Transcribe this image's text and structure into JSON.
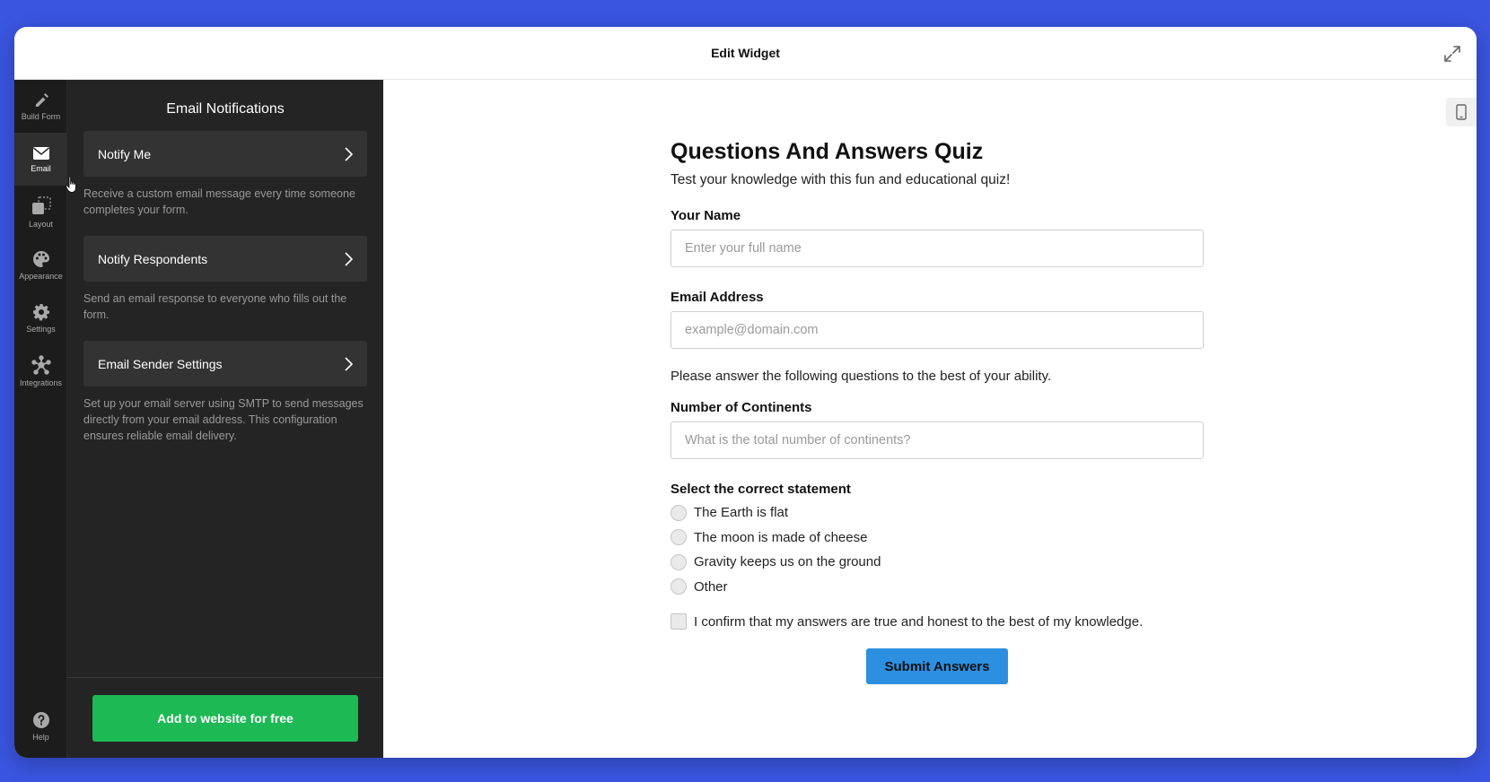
{
  "window": {
    "title": "Edit Widget"
  },
  "rail": {
    "items": [
      {
        "label": "Build Form",
        "icon": "pencil-icon"
      },
      {
        "label": "Email",
        "icon": "envelope-icon",
        "active": true
      },
      {
        "label": "Layout",
        "icon": "layout-icon"
      },
      {
        "label": "Appearance",
        "icon": "palette-icon"
      },
      {
        "label": "Settings",
        "icon": "gear-icon"
      },
      {
        "label": "Integrations",
        "icon": "integrations-icon"
      }
    ],
    "help": {
      "label": "Help",
      "icon": "help-icon"
    }
  },
  "panel": {
    "title": "Email Notifications",
    "cards": [
      {
        "label": "Notify Me",
        "desc": "Receive a custom email message every time someone completes your form."
      },
      {
        "label": "Notify Respondents",
        "desc": "Send an email response to everyone who fills out the form."
      },
      {
        "label": "Email Sender Settings",
        "desc": "Set up your email server using SMTP to send messages directly from your email address. This configuration ensures reliable email delivery."
      }
    ],
    "add_button": "Add to website for free"
  },
  "form": {
    "title": "Questions And Answers Quiz",
    "subtitle": "Test your knowledge with this fun and educational quiz!",
    "name_label": "Your Name",
    "name_placeholder": "Enter your full name",
    "email_label": "Email Address",
    "email_placeholder": "example@domain.com",
    "instructions": "Please answer the following questions to the best of your ability.",
    "continents_label": "Number of Continents",
    "continents_placeholder": "What is the total number of continents?",
    "statement_label": "Select the correct statement",
    "options": [
      "The Earth is flat",
      "The moon is made of cheese",
      "Gravity keeps us on the ground",
      "Other"
    ],
    "confirm_text": "I confirm that my answers are true and honest to the best of my knowledge.",
    "submit_label": "Submit Answers"
  },
  "colors": {
    "background": "#3a55e0",
    "sidebar": "#242424",
    "rail": "#1c1c1c",
    "accent_green": "#1db954",
    "submit_blue": "#2d8fe0"
  }
}
